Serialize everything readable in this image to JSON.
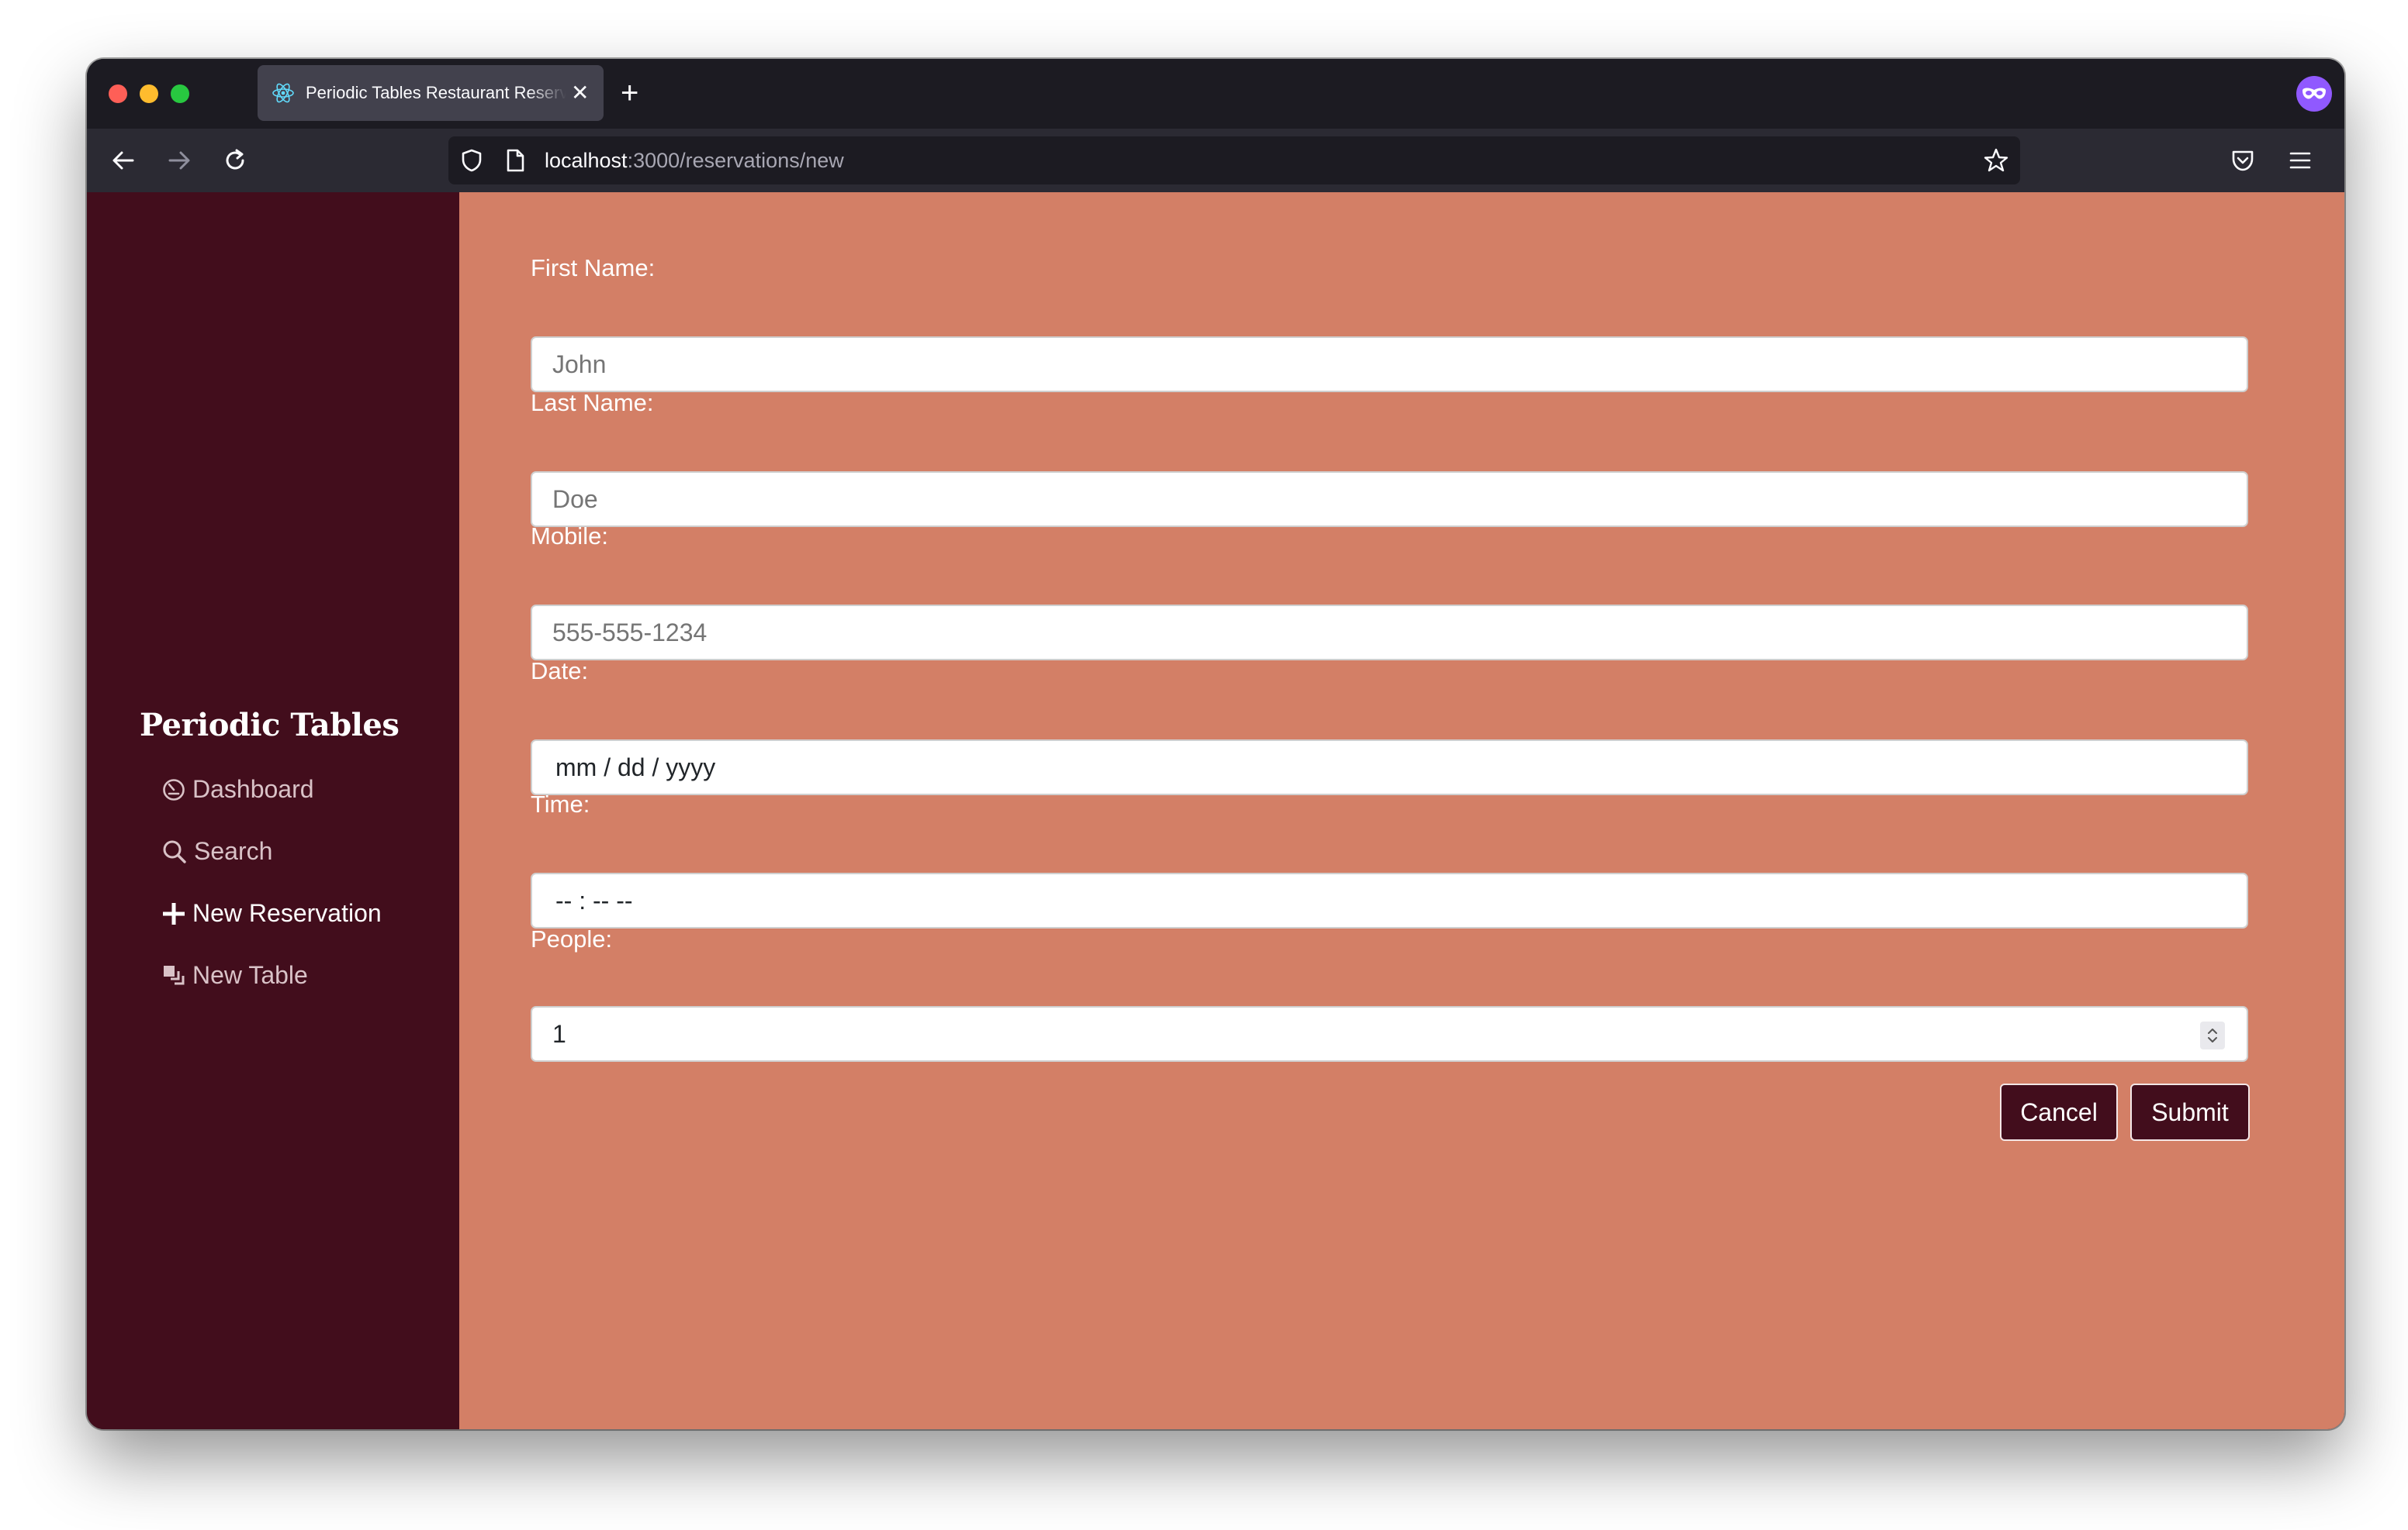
{
  "browser": {
    "tab_title": "Periodic Tables Restaurant Reservation",
    "url_host": "localhost",
    "url_path": ":3000/reservations/new"
  },
  "sidebar": {
    "brand": "Periodic Tables",
    "items": [
      {
        "label": "Dashboard",
        "icon": "dashboard-icon"
      },
      {
        "label": "Search",
        "icon": "search-icon"
      },
      {
        "label": "New Reservation",
        "icon": "plus-icon"
      },
      {
        "label": "New Table",
        "icon": "table-icon"
      }
    ]
  },
  "form": {
    "first_name": {
      "label": "First Name:",
      "placeholder": "John"
    },
    "last_name": {
      "label": "Last Name:",
      "placeholder": "Doe"
    },
    "mobile": {
      "label": "Mobile:",
      "placeholder": "555-555-1234"
    },
    "date": {
      "label": "Date:",
      "placeholder": "mm / dd / yyyy"
    },
    "time": {
      "label": "Time:",
      "placeholder": "-- : --  --"
    },
    "people": {
      "label": "People:",
      "value": "1"
    },
    "cancel_label": "Cancel",
    "submit_label": "Submit"
  },
  "colors": {
    "sidebar_bg": "#420d1c",
    "main_bg": "#d37f66",
    "button_bg": "#420d1c"
  }
}
